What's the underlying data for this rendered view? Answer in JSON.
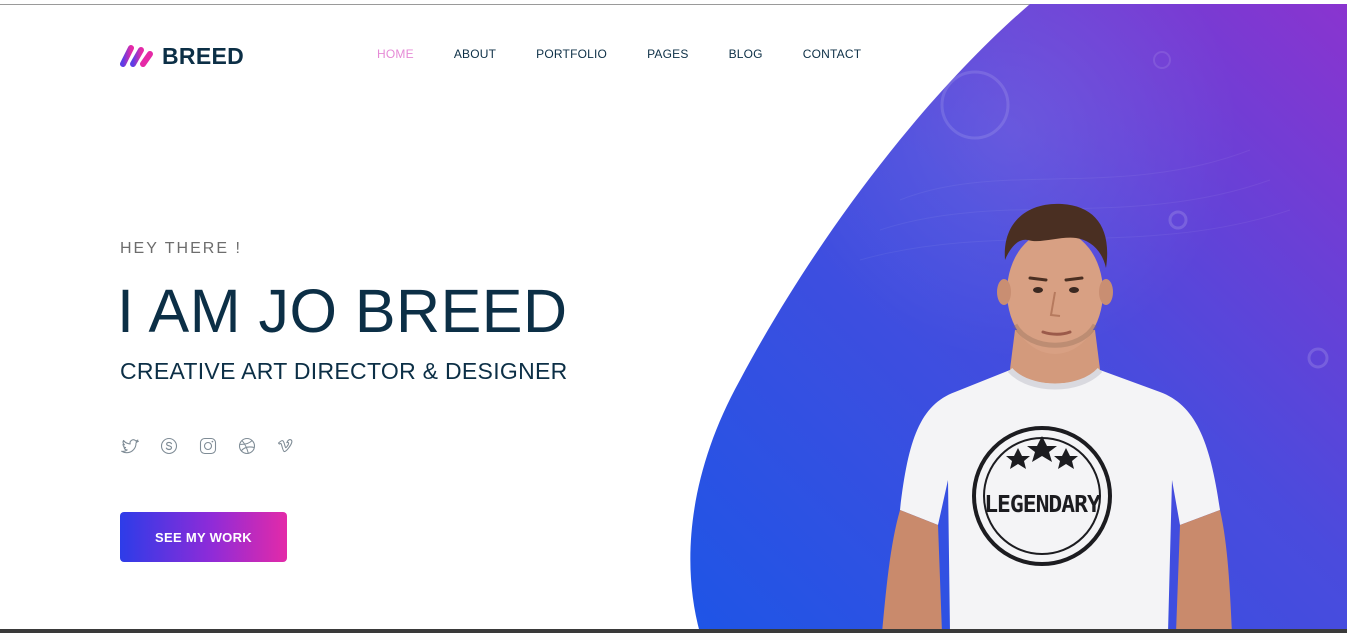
{
  "brand": {
    "name": "BREED",
    "accent": "#7a3ce0",
    "accent2": "#e52aa6"
  },
  "nav": {
    "items": [
      {
        "label": "HOME",
        "active": true
      },
      {
        "label": "ABOUT"
      },
      {
        "label": "PORTFOLIO"
      },
      {
        "label": "PAGES"
      },
      {
        "label": "BLOG"
      },
      {
        "label": "CONTACT"
      }
    ],
    "active_color": "#e58ad6"
  },
  "hero": {
    "eyebrow": "HEY THERE !",
    "headline": "I AM JO BREED",
    "subline": "CREATIVE ART DIRECTOR & DESIGNER",
    "cta_label": "SEE MY WORK",
    "shirt_text": "LEGENDARY",
    "gradient": [
      "#2450e4",
      "#8a34cf"
    ]
  },
  "socials": [
    {
      "icon": "twitter-icon"
    },
    {
      "icon": "skype-icon"
    },
    {
      "icon": "instagram-icon"
    },
    {
      "icon": "dribbble-icon"
    },
    {
      "icon": "vimeo-icon"
    }
  ],
  "colors": {
    "text": "#0c2f46",
    "muted": "#6d6d6d"
  }
}
